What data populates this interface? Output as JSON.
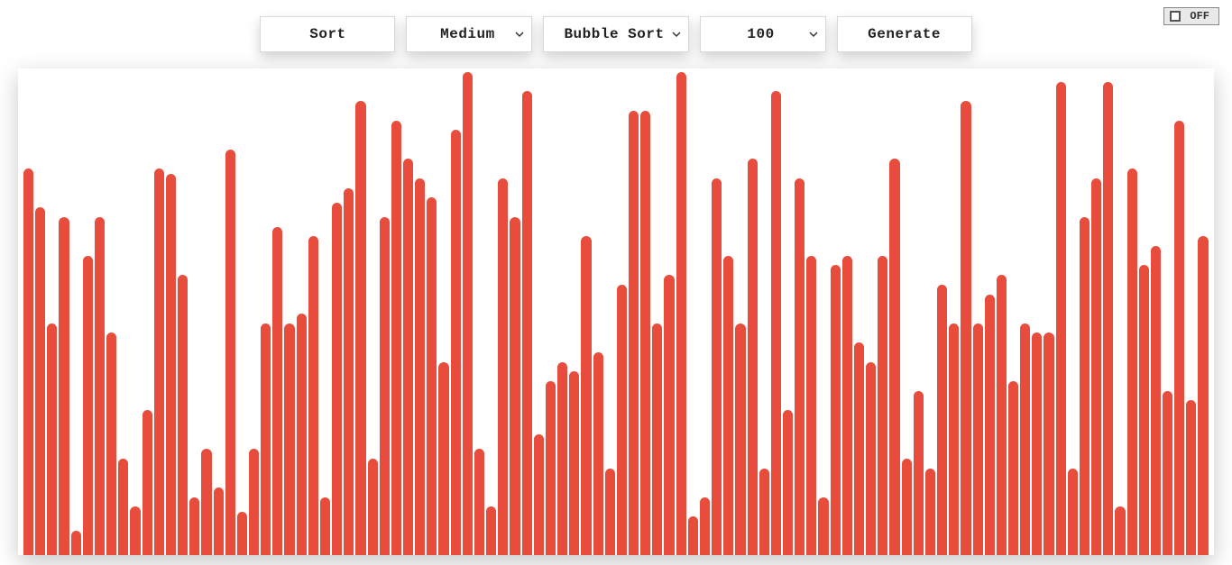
{
  "toolbar": {
    "sort_label": "Sort",
    "generate_label": "Generate",
    "speed_selected": "Medium",
    "algorithm_selected": "Bubble Sort",
    "count_selected": "100"
  },
  "toggle": {
    "label": "OFF"
  },
  "colors": {
    "bar": "#e74c3c",
    "panel_bg": "#ffffff"
  },
  "chart_data": {
    "type": "bar",
    "title": "",
    "xlabel": "",
    "ylabel": "",
    "ylim": [
      0,
      100
    ],
    "categories_note": "indices 0..99 (no axis labels shown)",
    "values": [
      80,
      72,
      48,
      70,
      5,
      62,
      70,
      46,
      20,
      10,
      30,
      80,
      79,
      58,
      12,
      22,
      14,
      84,
      9,
      22,
      48,
      68,
      48,
      50,
      66,
      12,
      73,
      76,
      94,
      20,
      70,
      90,
      82,
      78,
      74,
      40,
      88,
      100,
      22,
      10,
      78,
      70,
      96,
      25,
      36,
      40,
      38,
      66,
      42,
      18,
      56,
      92,
      92,
      48,
      58,
      100,
      8,
      12,
      78,
      62,
      48,
      82,
      18,
      96,
      30,
      78,
      62,
      12,
      60,
      62,
      44,
      40,
      62,
      82,
      20,
      34,
      18,
      56,
      48,
      94,
      48,
      54,
      58,
      36,
      48,
      46,
      46,
      98,
      18,
      70,
      78,
      98,
      10,
      80,
      60,
      64,
      34,
      90,
      32,
      66
    ]
  }
}
